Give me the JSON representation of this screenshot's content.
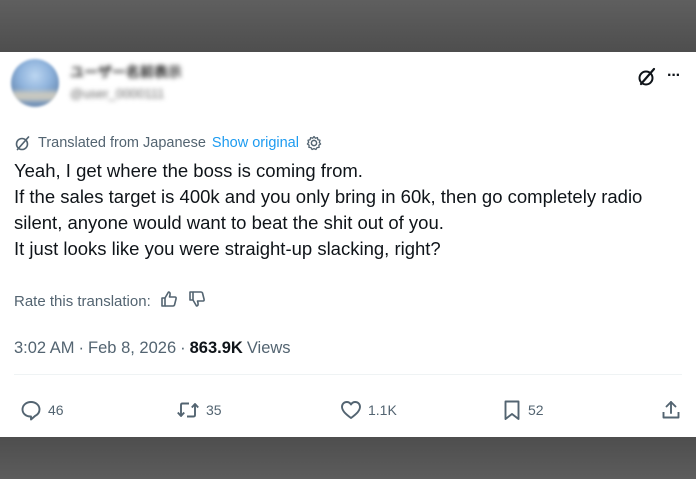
{
  "author": {
    "display_name": "ユーザー名前表示",
    "handle": "@user_0000111"
  },
  "header": {
    "grok_icon": "grok-icon",
    "more_icon": "more-icon",
    "more_label": "···"
  },
  "translation": {
    "notice": "Translated from Japanese",
    "show_original": "Show original",
    "rate_label": "Rate this translation:"
  },
  "post": {
    "lines": [
      "Yeah, I get where the boss is coming from.",
      "If the sales target is 400k and you only bring in 60k, then go completely radio silent, anyone would want to beat the shit out of you.",
      "It just looks like you were straight-up slacking, right?"
    ]
  },
  "meta": {
    "time": "3:02 AM",
    "separator": "·",
    "date": "Feb 8, 2026",
    "views_count": "863.9K",
    "views_label": "Views"
  },
  "actions": {
    "replies": "46",
    "reposts": "35",
    "likes": "1.1K",
    "bookmarks": "52"
  },
  "colors": {
    "text": "#0f1419",
    "muted": "#536471",
    "link": "#1d9bf0",
    "background_band": "#5a5a5a"
  }
}
